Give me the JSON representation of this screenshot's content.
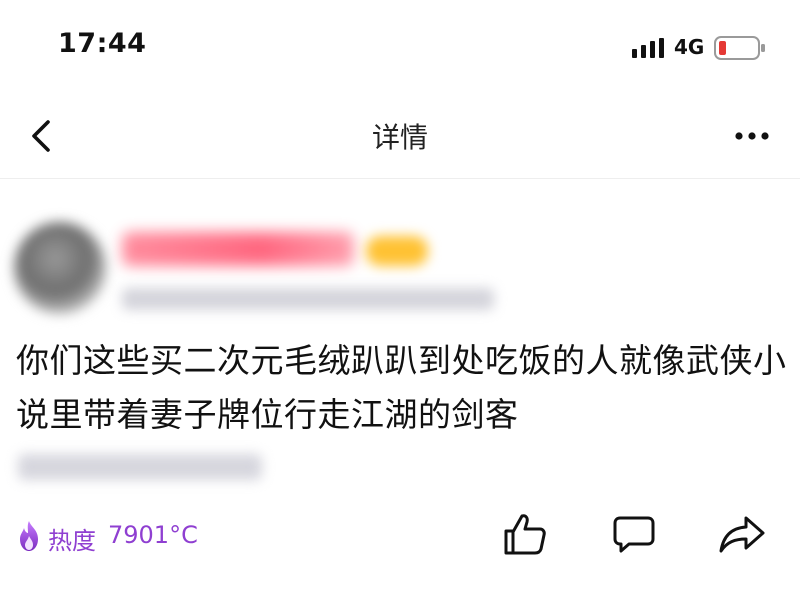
{
  "status_bar": {
    "time": "17:44",
    "network": "4G",
    "battery_color": "#e53935",
    "icons": [
      "signal-icon",
      "battery-icon"
    ]
  },
  "nav": {
    "title": "详情",
    "icons": [
      "back-icon",
      "more-icon"
    ]
  },
  "post": {
    "text": "你们这些买二次元毛绒趴趴到处吃饭的人就像武侠小说里带着妻子牌位行走江湖的剑客",
    "heat_label": "热度",
    "heat_value": "7901°C",
    "heat_color": "#8f3fd1",
    "actions": [
      "like-icon",
      "comment-icon",
      "share-icon"
    ]
  }
}
